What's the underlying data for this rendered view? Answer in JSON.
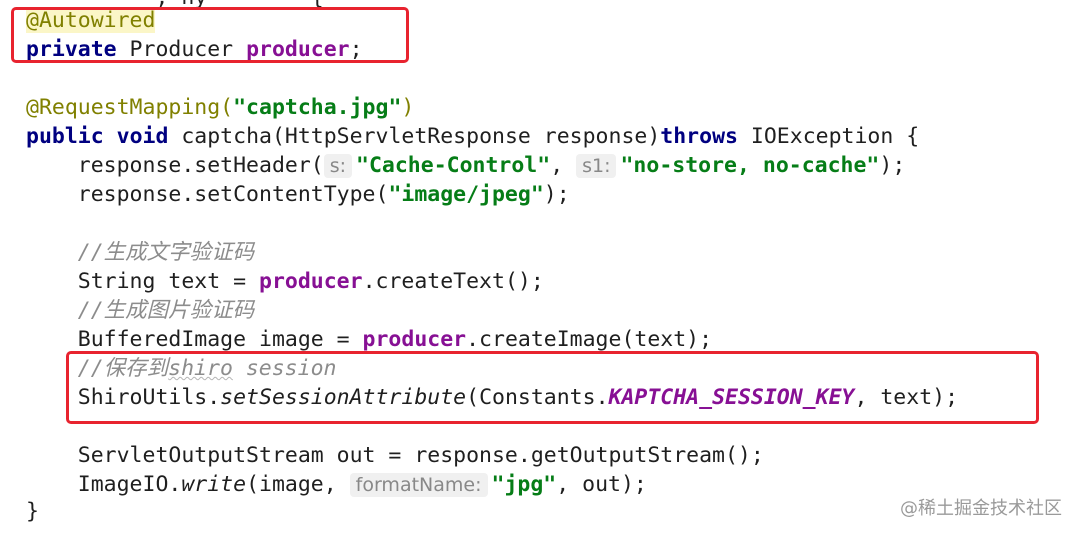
{
  "code": {
    "line0_text": "          , ny        {",
    "line1_annotation": "@Autowired",
    "line2_kw": "private",
    "line2_type": " Producer ",
    "line2_field": "producer",
    "line2_end": ";",
    "line4_annotation": "@RequestMapping(",
    "line4_str": "\"captcha.jpg\"",
    "line4_end": ")",
    "line5_kw1": "public",
    "line5_kw2": "void",
    "line5_sig": " captcha(HttpServletResponse response)",
    "line5_kw3": "throws",
    "line5_end": " IOException {",
    "line6_start": "    response.setHeader(",
    "line6_hint1": "s:",
    "line6_str1": "\"Cache-Control\"",
    "line6_mid": ", ",
    "line6_hint2": "s1:",
    "line6_str2": "\"no-store, no-cache\"",
    "line6_end": ");",
    "line7_start": "    response.setContentType(",
    "line7_str": "\"image/jpeg\"",
    "line7_end": ");",
    "line9_comment": "    //生成文字验证码",
    "line10_start": "    String text = ",
    "line10_field": "producer",
    "line10_end": ".createText();",
    "line11_comment": "    //生成图片验证码",
    "line12_start": "    BufferedImage image = ",
    "line12_field": "producer",
    "line12_end": ".createImage(text);",
    "line13_comment_a": "    //保存到",
    "line13_comment_b": "shiro",
    "line13_comment_c": " session",
    "line14_start": "    ShiroUtils.",
    "line14_static": "setSessionAttribute",
    "line14_mid": "(Constants.",
    "line14_const": "KAPTCHA_SESSION_KEY",
    "line14_end": ", text);",
    "line16_text": "    ServletOutputStream out = response.getOutputStream();",
    "line17_start": "    ImageIO.",
    "line17_static": "write",
    "line17_mid": "(image, ",
    "line17_hint": "formatName:",
    "line17_str": "\"jpg\"",
    "line17_end": ", out);",
    "line18_text": "}"
  },
  "watermark": "@稀土掘金技术社区",
  "colors": {
    "keyword": "#000080",
    "annotation": "#808000",
    "string": "#067d17",
    "field": "#871094",
    "comment": "#8c8c8c",
    "highlight_box": "#e8232f"
  }
}
